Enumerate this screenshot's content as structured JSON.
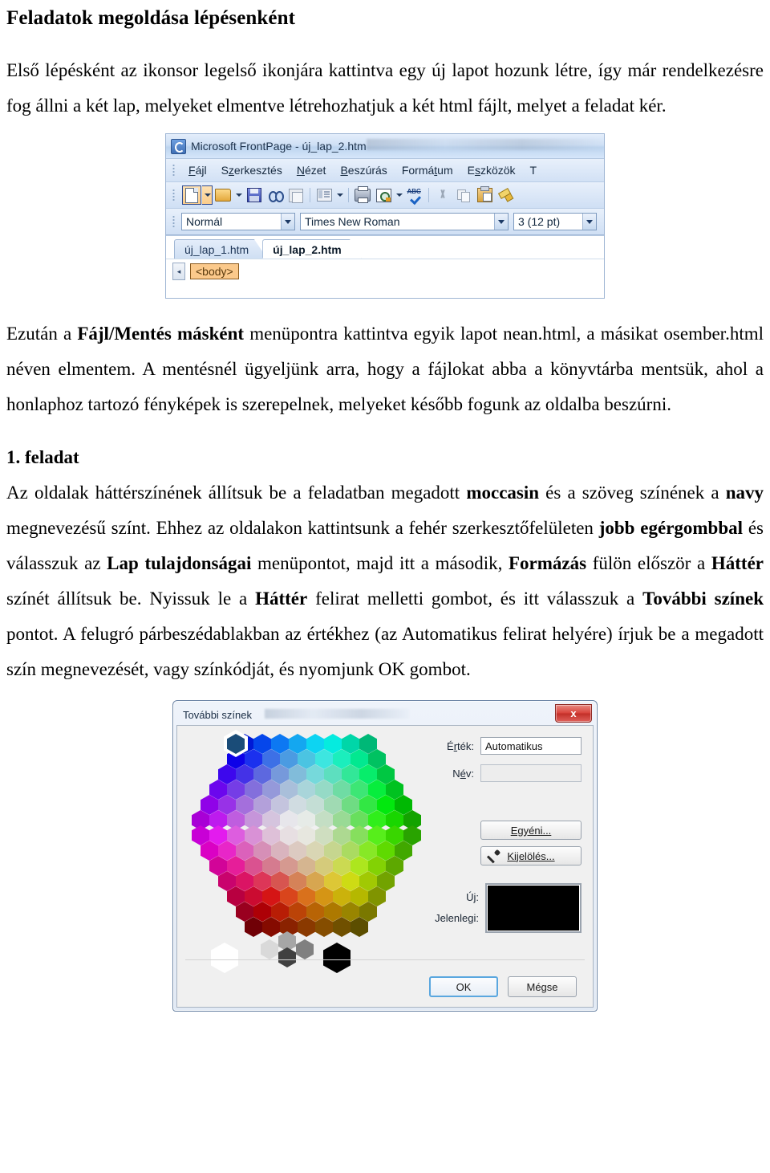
{
  "document": {
    "title": "Feladatok megoldása lépésenként",
    "paragraph_1": "Első lépésként az ikonsor legelső ikonjára kattintva egy új lapot hozunk létre, így már rendelkezésre fog állni a két lap, melyeket elmentve létrehozhatjuk a két html fájlt, melyet a feladat kér.",
    "paragraph_2_parts": {
      "a": "Ezután a ",
      "b_bold": "Fájl/Mentés másként",
      "c": " menüpontra kattintva egyik lapot nean.html, a másikat osember.html néven elmentem. A mentésnél ügyeljünk arra, hogy a fájlokat abba a könyvtárba mentsük, ahol a honlaphoz tartozó fényképek is szerepelnek, melyeket később fogunk az oldalba beszúrni."
    },
    "task_title": "1. feladat",
    "paragraph_3_parts": {
      "a": "Az oldalak háttérszínének állítsuk be a feladatban megadott ",
      "b_bold": "moccasin",
      "c": " és a szöveg színének a ",
      "d_bold": "navy",
      "e": " megnevezésű színt. Ehhez az oldalakon kattintsunk a fehér szerkesztőfelületen ",
      "f_bold": "jobb egérgombbal",
      "g": " és válasszuk az ",
      "h_bold": "Lap tulajdonságai",
      "i": " menüpontot, majd itt a második, ",
      "j_bold": "Formázás",
      "k": " fülön először a ",
      "l_bold": "Háttér",
      "m": " színét állítsuk be. Nyissuk le a ",
      "n_bold": "Háttér",
      "o": " felirat melletti gombot, és itt válasszuk a ",
      "p_bold": "További színek",
      "q": " pontot. A felugró párbeszédablakban az értékhez (az Automatikus felirat helyére) írjuk be a megadott szín megnevezését, vagy színkódját, és nyomjunk OK gombot."
    }
  },
  "frontpage_window": {
    "title": "Microsoft FrontPage - új_lap_2.htm",
    "menu_items": [
      "Fájl",
      "Szerkesztés",
      "Nézet",
      "Beszúrás",
      "Formátum",
      "Eszközök",
      "T"
    ],
    "toolbar_icons": [
      "new-document-icon",
      "new-document-dropdown-icon",
      "open-icon",
      "open-dropdown-icon",
      "save-icon",
      "find-icon",
      "pages-icon",
      "task-panel-icon",
      "task-panel-dropdown-icon",
      "print-icon",
      "print-preview-icon",
      "print-preview-dropdown-icon",
      "spelling-icon",
      "cut-icon",
      "copy-icon",
      "paste-icon",
      "format-painter-icon"
    ],
    "format_bar": {
      "style": "Normál",
      "font": "Times New Roman",
      "size": "3 (12 pt)"
    },
    "tabs": [
      {
        "label": "új_lap_1.htm",
        "active": false
      },
      {
        "label": "új_lap_2.htm",
        "active": true
      }
    ],
    "tag_bar": {
      "scroll_left": "◂",
      "tag": "<body>"
    }
  },
  "color_dialog": {
    "title": "További színek",
    "close_label": "x",
    "fields": [
      {
        "label_pre": "É",
        "label_underline": "r",
        "label_post": "ték:",
        "value": "Automatikus",
        "disabled": false
      },
      {
        "label_pre": "N",
        "label_underline": "é",
        "label_post": "v:",
        "value": "",
        "disabled": true
      }
    ],
    "buttons": {
      "custom": "Egyéni...",
      "pick": "Kijelölés...",
      "ok": "OK",
      "cancel": "Mégse"
    },
    "preview": {
      "new_label": "Új:",
      "current_label": "Jelenlegi:",
      "color": "#000000"
    },
    "selected_swatch_color": "#1a4c78",
    "gray_swatches": [
      "#ffffff",
      "#d9d9d9",
      "#a6a6a6",
      "#808080",
      "#404040",
      "#000000"
    ]
  }
}
